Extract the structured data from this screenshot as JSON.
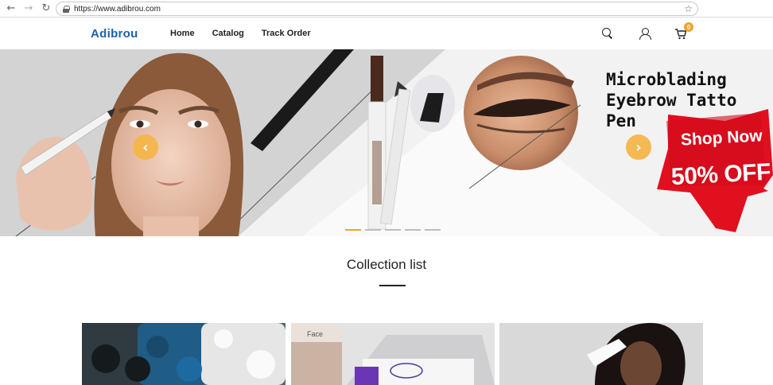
{
  "browser": {
    "url": "https://www.adibrou.com",
    "back_icon": "arrow-left-icon",
    "forward_icon": "arrow-right-icon",
    "reload_icon": "reload-icon",
    "bookmark_icon": "star-icon"
  },
  "header": {
    "logo": "Adibrou",
    "nav": [
      "Home",
      "Catalog",
      "Track Order"
    ],
    "cart_count": "0",
    "accent_color": "#f2a12e",
    "brand_color": "#1d5fa8"
  },
  "hero": {
    "headline_line1": "Microblading",
    "headline_line2": "Eyebrow Tatto",
    "headline_line3": "Pen",
    "promo_line1": "Shop Now",
    "promo_line2": "50% OFF",
    "slides_total": 5,
    "active_slide": 1,
    "prev_icon": "chevron-left-icon",
    "next_icon": "chevron-right-icon"
  },
  "collection": {
    "title": "Collection list",
    "card_2_caption": "Face"
  }
}
